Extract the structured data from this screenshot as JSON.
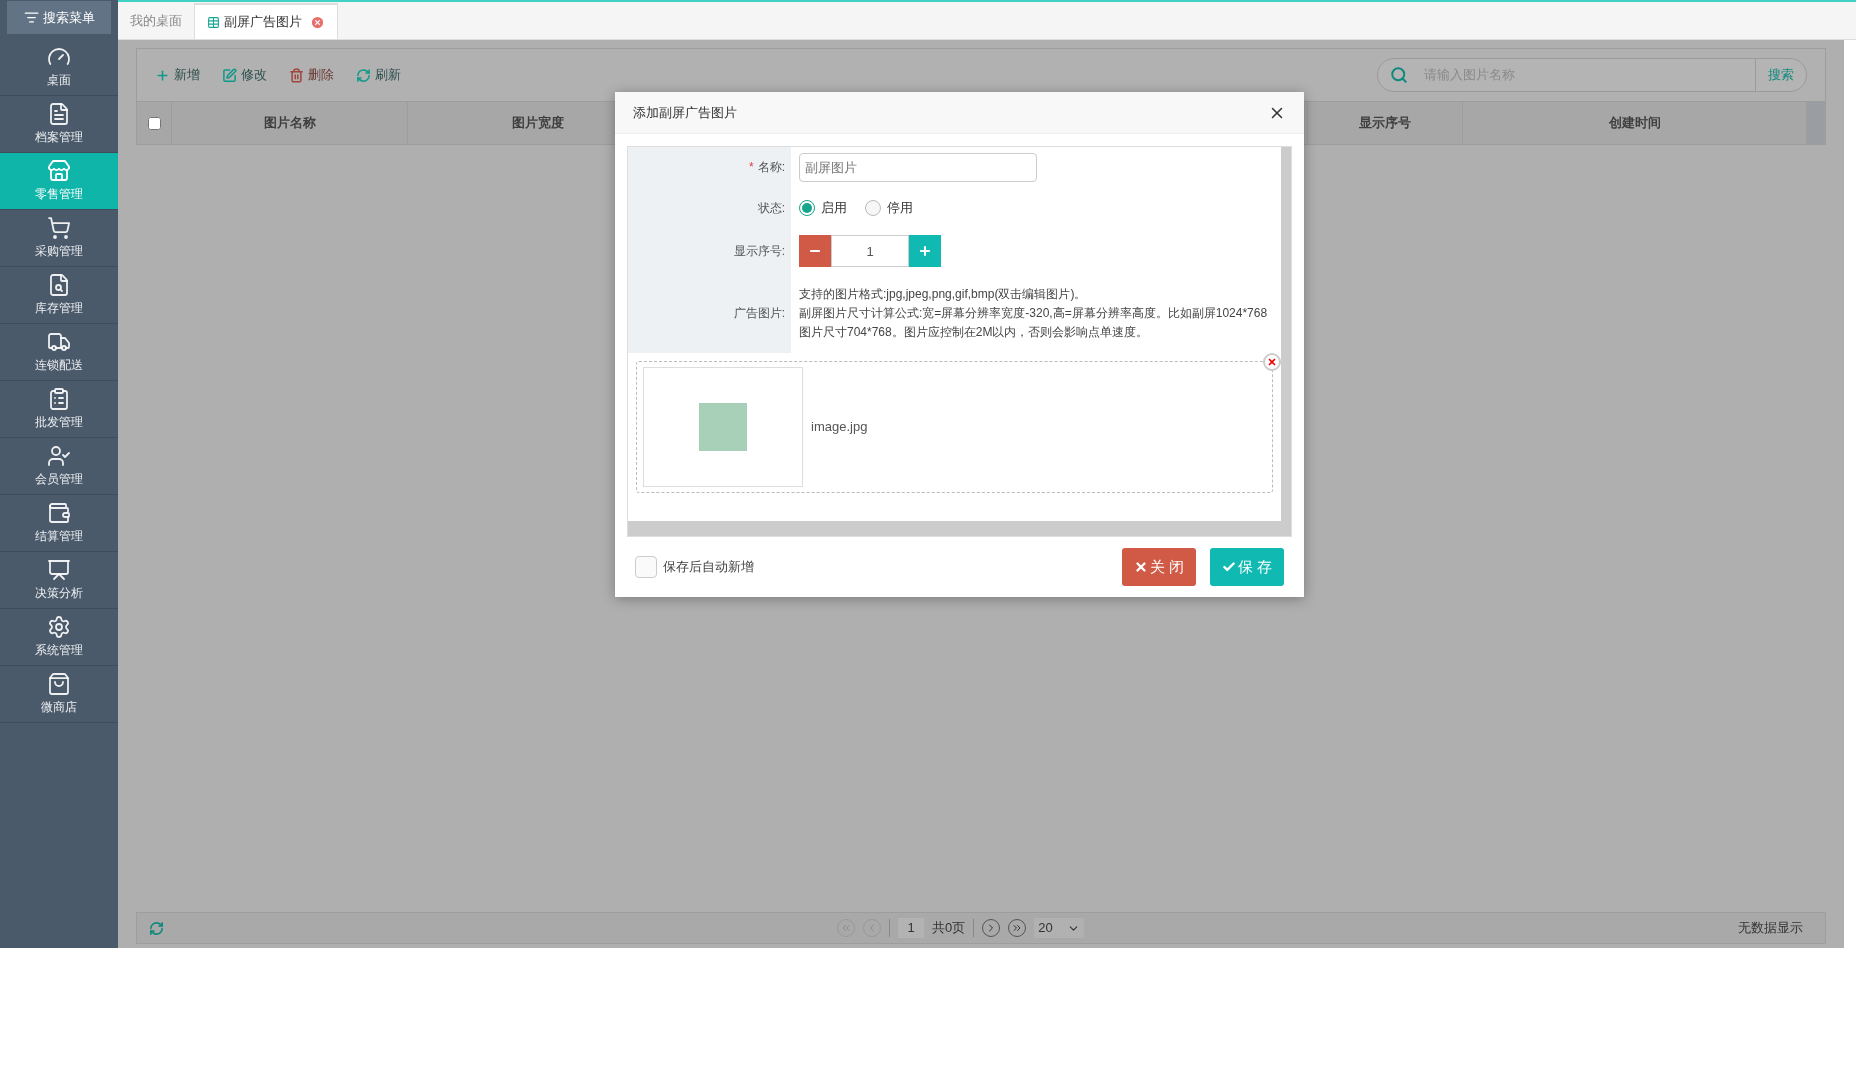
{
  "sidebar": {
    "search_label": "搜索菜单",
    "items": [
      {
        "kind": "dashboard",
        "label": "桌面",
        "selected": false
      },
      {
        "kind": "archive",
        "label": "档案管理",
        "selected": false
      },
      {
        "kind": "store",
        "label": "零售管理",
        "selected": true
      },
      {
        "kind": "cart",
        "label": "采购管理",
        "selected": false
      },
      {
        "kind": "inventory",
        "label": "库存管理",
        "selected": false
      },
      {
        "kind": "truck",
        "label": "连锁配送",
        "selected": false
      },
      {
        "kind": "wholesale",
        "label": "批发管理",
        "selected": false
      },
      {
        "kind": "member",
        "label": "会员管理",
        "selected": false
      },
      {
        "kind": "settle",
        "label": "结算管理",
        "selected": false
      },
      {
        "kind": "analysis",
        "label": "决策分析",
        "selected": false
      },
      {
        "kind": "settings",
        "label": "系统管理",
        "selected": false
      },
      {
        "kind": "shop",
        "label": "微商店",
        "selected": false
      }
    ]
  },
  "tabs": [
    {
      "label": "我的桌面",
      "selected": false,
      "closable": false
    },
    {
      "label": "副屏广告图片",
      "selected": true,
      "closable": true
    }
  ],
  "toolbar": {
    "buttons": [
      {
        "kind": "add",
        "label": "新增"
      },
      {
        "kind": "edit",
        "label": "修改"
      },
      {
        "kind": "delete",
        "label": "删除"
      },
      {
        "kind": "refresh",
        "label": "刷新"
      }
    ],
    "search": {
      "placeholder": "请输入图片名称",
      "button": "搜索"
    }
  },
  "table": {
    "select_all_checked": false,
    "columns": [
      "图片名称",
      "图片宽度",
      "显示序号",
      "创建时间"
    ]
  },
  "pager": {
    "page": "1",
    "total": "共0页",
    "page_size": "20",
    "status": "无数据显示"
  },
  "dialog": {
    "title": "添加副屏广告图片",
    "name": {
      "label": "名称:",
      "required_mark": "*",
      "placeholder": "副屏图片"
    },
    "status": {
      "label": "状态:",
      "options": [
        {
          "label": "启用",
          "selected": true
        },
        {
          "label": "停用",
          "selected": false
        }
      ]
    },
    "order": {
      "label": "显示序号:",
      "value": "1"
    },
    "image": {
      "label": "广告图片:",
      "notes": [
        "支持的图片格式:jpg,jpeg,png,gif,bmp(双击编辑图片)。",
        "副屏图片尺寸计算公式:宽=屏幕分辨率宽度-320,高=屏幕分辨率高度。比如副屏1024*768 图片尺寸704*768。图片应控制在2M以内，否则会影响点单速度。"
      ],
      "file_name": "image.jpg"
    },
    "auto_add": {
      "label": "保存后自动新增",
      "checked": false
    },
    "buttons": [
      {
        "kind": "close",
        "label": "关 闭"
      },
      {
        "kind": "save",
        "label": "保 存"
      }
    ]
  }
}
